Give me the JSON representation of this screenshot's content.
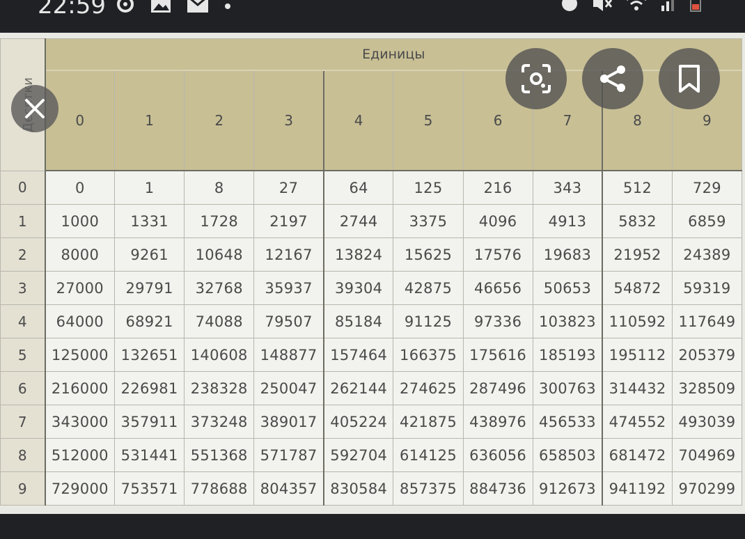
{
  "status_bar": {
    "time": "22:59",
    "icons_left": [
      "sync-icon",
      "gallery-icon",
      "mail-icon",
      "dot-icon"
    ],
    "icons_right": [
      "alarm-icon",
      "mute-icon",
      "wifi-icon",
      "signal-icon",
      "battery-icon"
    ]
  },
  "table": {
    "corner_label": "Десятки",
    "units_label": "Единицы",
    "unit_digits": [
      "0",
      "1",
      "2",
      "3",
      "4",
      "5",
      "6",
      "7",
      "8",
      "9"
    ],
    "rows": [
      {
        "tens": "0",
        "values": [
          "0",
          "1",
          "8",
          "27",
          "64",
          "125",
          "216",
          "343",
          "512",
          "729"
        ]
      },
      {
        "tens": "1",
        "values": [
          "1000",
          "1331",
          "1728",
          "2197",
          "2744",
          "3375",
          "4096",
          "4913",
          "5832",
          "6859"
        ]
      },
      {
        "tens": "2",
        "values": [
          "8000",
          "9261",
          "10648",
          "12167",
          "13824",
          "15625",
          "17576",
          "19683",
          "21952",
          "24389"
        ]
      },
      {
        "tens": "3",
        "values": [
          "27000",
          "29791",
          "32768",
          "35937",
          "39304",
          "42875",
          "46656",
          "50653",
          "54872",
          "59319"
        ]
      },
      {
        "tens": "4",
        "values": [
          "64000",
          "68921",
          "74088",
          "79507",
          "85184",
          "91125",
          "97336",
          "103823",
          "110592",
          "117649"
        ]
      },
      {
        "tens": "5",
        "values": [
          "125000",
          "132651",
          "140608",
          "148877",
          "157464",
          "166375",
          "175616",
          "185193",
          "195112",
          "205379"
        ]
      },
      {
        "tens": "6",
        "values": [
          "216000",
          "226981",
          "238328",
          "250047",
          "262144",
          "274625",
          "287496",
          "300763",
          "314432",
          "328509"
        ]
      },
      {
        "tens": "7",
        "values": [
          "343000",
          "357911",
          "373248",
          "389017",
          "405224",
          "421875",
          "438976",
          "456533",
          "474552",
          "493039"
        ]
      },
      {
        "tens": "8",
        "values": [
          "512000",
          "531441",
          "551368",
          "571787",
          "592704",
          "614125",
          "636056",
          "658503",
          "681472",
          "704969"
        ]
      },
      {
        "tens": "9",
        "values": [
          "729000",
          "753571",
          "778688",
          "804357",
          "830584",
          "857375",
          "884736",
          "912673",
          "941192",
          "970299"
        ]
      }
    ]
  },
  "overlay": {
    "buttons": [
      "close-icon",
      "lens-icon",
      "share-icon",
      "bookmark-icon"
    ]
  },
  "colors": {
    "header_bg": "#c8bf95",
    "row_header_bg": "#e4e1d3",
    "cell_bg": "#f2f2ee",
    "dark_bg": "#1f2124"
  }
}
